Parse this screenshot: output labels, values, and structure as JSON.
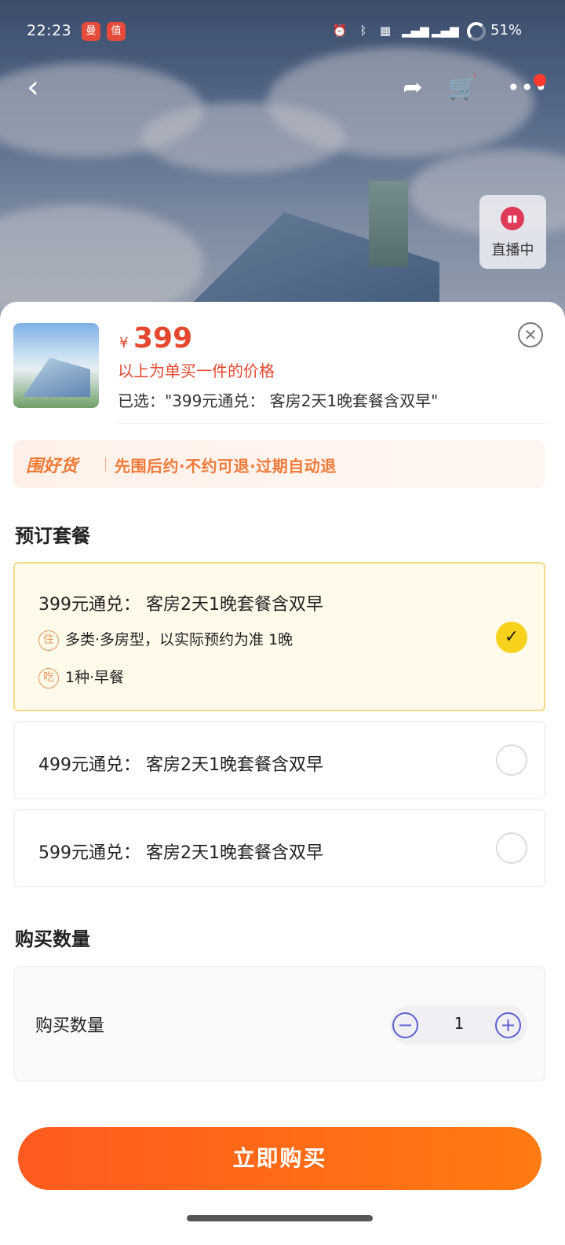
{
  "status_bar": {
    "time": "22:23",
    "app_badges": [
      "曼",
      "值"
    ],
    "battery": "51%"
  },
  "hero": {
    "live_label": "直播中"
  },
  "sheet": {
    "currency": "¥",
    "price": "399",
    "price_note": "以上为单买一件的价格",
    "selected": "已选：\"399元通兑： 客房2天1晚套餐含双早\"",
    "close_icon": "close-icon"
  },
  "banner": {
    "brand": "围好货",
    "slogan": "先围后约·不约可退·过期自动退"
  },
  "packages": {
    "title": "预订套餐",
    "items": [
      {
        "name": "399元通兑： 客房2天1晚套餐含双早",
        "selected": true,
        "features": [
          {
            "icon": "住",
            "text": "多类·多房型，以实际预约为准 1晚"
          },
          {
            "icon": "吃",
            "text": "1种·早餐"
          }
        ]
      },
      {
        "name": "499元通兑： 客房2天1晚套餐含双早",
        "selected": false
      },
      {
        "name": "599元通兑： 客房2天1晚套餐含双早",
        "selected": false
      }
    ]
  },
  "quantity": {
    "section_title": "购买数量",
    "label": "购买数量",
    "value": "1"
  },
  "cta": {
    "buy_label": "立即购买"
  },
  "colors": {
    "accent": "#ff6a15",
    "price": "#e5482f",
    "check": "#f7d21d"
  }
}
